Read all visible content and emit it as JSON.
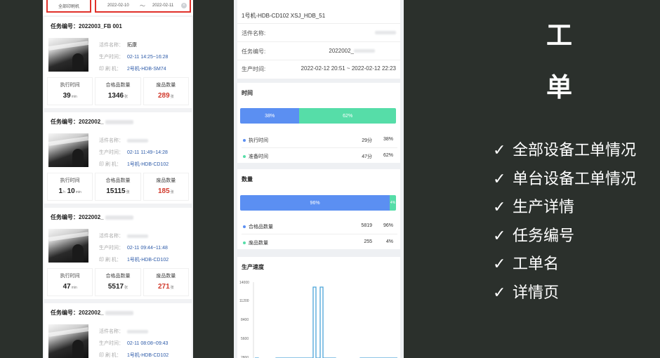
{
  "left_phone": {
    "filter": {
      "printer_label": "全部印刷机",
      "date_start": "2022-02-10",
      "date_separator": "〜",
      "date_end": "2022-02-11",
      "clear_icon": "clear-circle-icon"
    },
    "labels": {
      "task_no": "任务编号：",
      "job_name": "活件名称：",
      "production_time": "生产时间：",
      "printer": "印 刷 机：",
      "exec_time": "执行时间",
      "good_count": "合格品数量",
      "waste_count": "废品数量",
      "unit_min": "min",
      "unit_hour": "h",
      "unit_sheet": "张"
    },
    "tasks": [
      {
        "task_no": "2022003_FB 001",
        "job_name": "拓康",
        "time": "02-11 14:25~16:28",
        "printer": "2号机-HDB-SM74",
        "exec_hours": "",
        "exec_min": "39",
        "good": "1346",
        "waste": "289"
      },
      {
        "task_no": "2022002_",
        "job_name": "",
        "time": "02-11 11:49~14:28",
        "printer": "1号机-HDB-CD102",
        "exec_hours": "1",
        "exec_min": "10",
        "good": "15115",
        "waste": "185"
      },
      {
        "task_no": "2022002_",
        "job_name": "",
        "time": "02-11 09:44~11:48",
        "printer": "1号机-HDB-CD102",
        "exec_hours": "",
        "exec_min": "47",
        "good": "5517",
        "waste": "271"
      },
      {
        "task_no": "2022002_",
        "job_name": "",
        "time": "02-11 08:08~09:43",
        "printer": "1号机-HDB-CD102",
        "exec_hours": "",
        "exec_min": "",
        "good": "",
        "waste": ""
      }
    ]
  },
  "mid_phone": {
    "title": "1号机-HDB-CD102 XSJ_HDB_51",
    "job_name_label": "活件名称:",
    "task_no_label": "任务编号:",
    "task_no_value": "2022002_",
    "prod_time_label": "生产时间:",
    "prod_time_value": "2022-02-12 20:51 ~ 2022-02-12 22:23",
    "time_section": {
      "title": "时间",
      "exec_pct": 38,
      "prep_pct": 62,
      "exec_pct_label": "38%",
      "prep_pct_label": "62%",
      "rows": [
        {
          "label": "执行时间",
          "value": "29分",
          "pct": "38%"
        },
        {
          "label": "准备时间",
          "value": "47分",
          "pct": "62%"
        }
      ]
    },
    "count_section": {
      "title": "数量",
      "good_pct": 96,
      "waste_pct": 4,
      "good_pct_label": "96%",
      "waste_pct_label": "4%",
      "rows": [
        {
          "label": "合格品数量",
          "value": "5819",
          "pct": "96%"
        },
        {
          "label": "废品数量",
          "value": "255",
          "pct": "4%"
        }
      ]
    },
    "speed_section": {
      "title": "生产速度",
      "y_ticks": [
        "14000",
        "11200",
        "8400",
        "5600",
        "2800"
      ]
    }
  },
  "colors": {
    "accent_blue": "#5b8ff2",
    "accent_green": "#56dda8",
    "waste_red": "#d13a2c",
    "highlight_red": "#e0312a",
    "background": "#2b302c",
    "speed_line": "#4aa3d8"
  },
  "right_panel": {
    "heading_line1": "工",
    "heading_line2": "单",
    "features": [
      "全部设备工单情况",
      "单台设备工单情况",
      "生产详情",
      "任务编号",
      "工单名",
      "详情页"
    ],
    "check_icon": "checkmark-icon",
    "check_glyph": "✓"
  }
}
